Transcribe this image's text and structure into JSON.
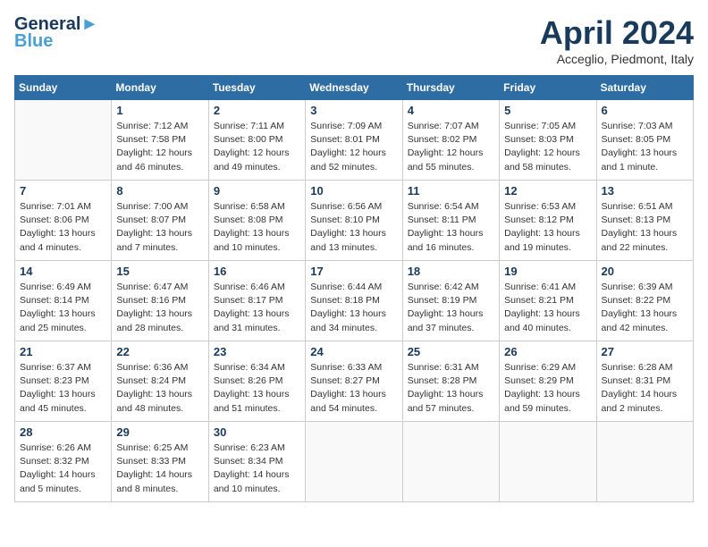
{
  "header": {
    "logo_line1": "General",
    "logo_line2": "Blue",
    "month": "April 2024",
    "location": "Acceglio, Piedmont, Italy"
  },
  "weekdays": [
    "Sunday",
    "Monday",
    "Tuesday",
    "Wednesday",
    "Thursday",
    "Friday",
    "Saturday"
  ],
  "weeks": [
    [
      {
        "day": "",
        "info": ""
      },
      {
        "day": "1",
        "info": "Sunrise: 7:12 AM\nSunset: 7:58 PM\nDaylight: 12 hours\nand 46 minutes."
      },
      {
        "day": "2",
        "info": "Sunrise: 7:11 AM\nSunset: 8:00 PM\nDaylight: 12 hours\nand 49 minutes."
      },
      {
        "day": "3",
        "info": "Sunrise: 7:09 AM\nSunset: 8:01 PM\nDaylight: 12 hours\nand 52 minutes."
      },
      {
        "day": "4",
        "info": "Sunrise: 7:07 AM\nSunset: 8:02 PM\nDaylight: 12 hours\nand 55 minutes."
      },
      {
        "day": "5",
        "info": "Sunrise: 7:05 AM\nSunset: 8:03 PM\nDaylight: 12 hours\nand 58 minutes."
      },
      {
        "day": "6",
        "info": "Sunrise: 7:03 AM\nSunset: 8:05 PM\nDaylight: 13 hours\nand 1 minute."
      }
    ],
    [
      {
        "day": "7",
        "info": "Sunrise: 7:01 AM\nSunset: 8:06 PM\nDaylight: 13 hours\nand 4 minutes."
      },
      {
        "day": "8",
        "info": "Sunrise: 7:00 AM\nSunset: 8:07 PM\nDaylight: 13 hours\nand 7 minutes."
      },
      {
        "day": "9",
        "info": "Sunrise: 6:58 AM\nSunset: 8:08 PM\nDaylight: 13 hours\nand 10 minutes."
      },
      {
        "day": "10",
        "info": "Sunrise: 6:56 AM\nSunset: 8:10 PM\nDaylight: 13 hours\nand 13 minutes."
      },
      {
        "day": "11",
        "info": "Sunrise: 6:54 AM\nSunset: 8:11 PM\nDaylight: 13 hours\nand 16 minutes."
      },
      {
        "day": "12",
        "info": "Sunrise: 6:53 AM\nSunset: 8:12 PM\nDaylight: 13 hours\nand 19 minutes."
      },
      {
        "day": "13",
        "info": "Sunrise: 6:51 AM\nSunset: 8:13 PM\nDaylight: 13 hours\nand 22 minutes."
      }
    ],
    [
      {
        "day": "14",
        "info": "Sunrise: 6:49 AM\nSunset: 8:14 PM\nDaylight: 13 hours\nand 25 minutes."
      },
      {
        "day": "15",
        "info": "Sunrise: 6:47 AM\nSunset: 8:16 PM\nDaylight: 13 hours\nand 28 minutes."
      },
      {
        "day": "16",
        "info": "Sunrise: 6:46 AM\nSunset: 8:17 PM\nDaylight: 13 hours\nand 31 minutes."
      },
      {
        "day": "17",
        "info": "Sunrise: 6:44 AM\nSunset: 8:18 PM\nDaylight: 13 hours\nand 34 minutes."
      },
      {
        "day": "18",
        "info": "Sunrise: 6:42 AM\nSunset: 8:19 PM\nDaylight: 13 hours\nand 37 minutes."
      },
      {
        "day": "19",
        "info": "Sunrise: 6:41 AM\nSunset: 8:21 PM\nDaylight: 13 hours\nand 40 minutes."
      },
      {
        "day": "20",
        "info": "Sunrise: 6:39 AM\nSunset: 8:22 PM\nDaylight: 13 hours\nand 42 minutes."
      }
    ],
    [
      {
        "day": "21",
        "info": "Sunrise: 6:37 AM\nSunset: 8:23 PM\nDaylight: 13 hours\nand 45 minutes."
      },
      {
        "day": "22",
        "info": "Sunrise: 6:36 AM\nSunset: 8:24 PM\nDaylight: 13 hours\nand 48 minutes."
      },
      {
        "day": "23",
        "info": "Sunrise: 6:34 AM\nSunset: 8:26 PM\nDaylight: 13 hours\nand 51 minutes."
      },
      {
        "day": "24",
        "info": "Sunrise: 6:33 AM\nSunset: 8:27 PM\nDaylight: 13 hours\nand 54 minutes."
      },
      {
        "day": "25",
        "info": "Sunrise: 6:31 AM\nSunset: 8:28 PM\nDaylight: 13 hours\nand 57 minutes."
      },
      {
        "day": "26",
        "info": "Sunrise: 6:29 AM\nSunset: 8:29 PM\nDaylight: 13 hours\nand 59 minutes."
      },
      {
        "day": "27",
        "info": "Sunrise: 6:28 AM\nSunset: 8:31 PM\nDaylight: 14 hours\nand 2 minutes."
      }
    ],
    [
      {
        "day": "28",
        "info": "Sunrise: 6:26 AM\nSunset: 8:32 PM\nDaylight: 14 hours\nand 5 minutes."
      },
      {
        "day": "29",
        "info": "Sunrise: 6:25 AM\nSunset: 8:33 PM\nDaylight: 14 hours\nand 8 minutes."
      },
      {
        "day": "30",
        "info": "Sunrise: 6:23 AM\nSunset: 8:34 PM\nDaylight: 14 hours\nand 10 minutes."
      },
      {
        "day": "",
        "info": ""
      },
      {
        "day": "",
        "info": ""
      },
      {
        "day": "",
        "info": ""
      },
      {
        "day": "",
        "info": ""
      }
    ]
  ]
}
